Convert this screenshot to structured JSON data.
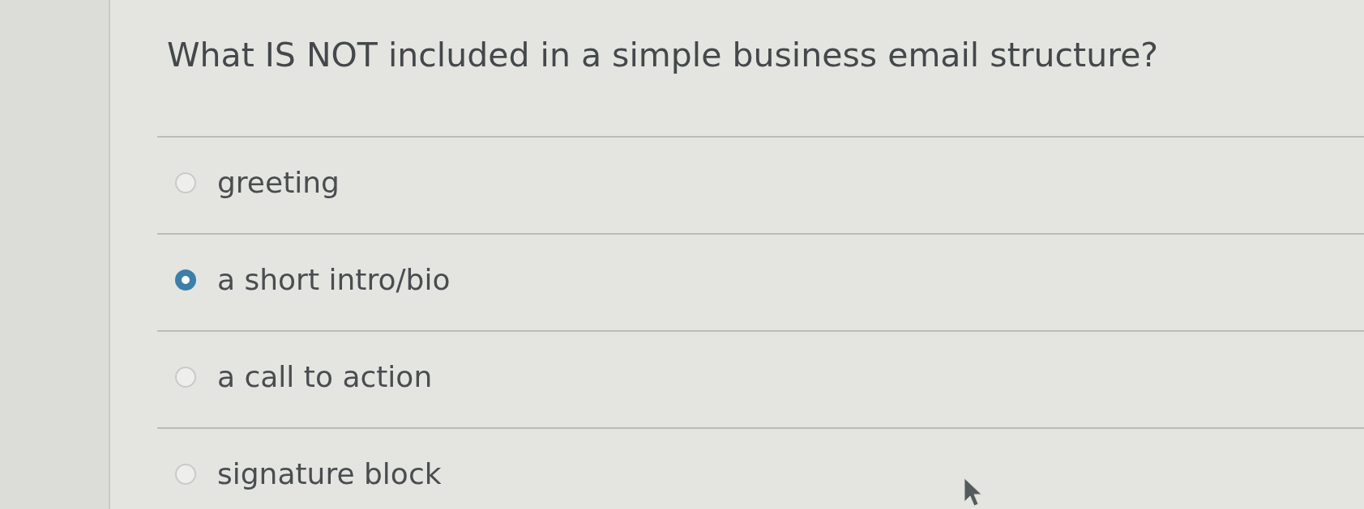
{
  "question": {
    "text": "What IS NOT included in a simple business email structure?"
  },
  "options": [
    {
      "label": "greeting",
      "selected": false
    },
    {
      "label": "a short intro/bio",
      "selected": true
    },
    {
      "label": "a call to action",
      "selected": false
    },
    {
      "label": "signature block",
      "selected": false
    }
  ]
}
